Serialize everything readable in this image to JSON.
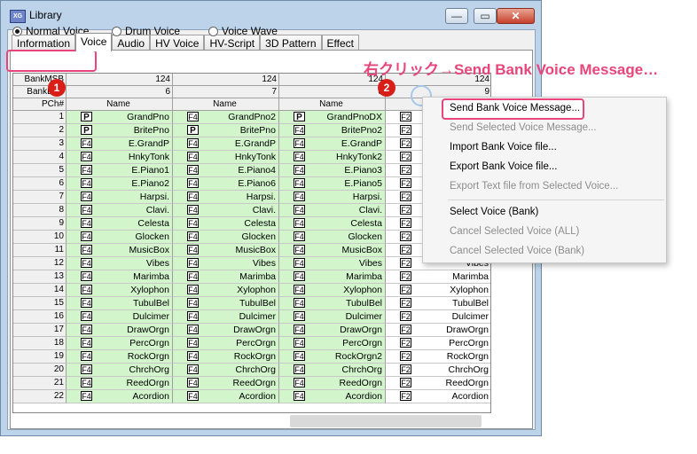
{
  "window": {
    "title": "Library",
    "icon_text": "XG",
    "buttons": {
      "minimize": "—",
      "maximize": "▭",
      "close": "✕"
    }
  },
  "tabs": [
    "Information",
    "Voice",
    "Audio",
    "HV Voice",
    "HV-Script",
    "3D Pattern",
    "Effect"
  ],
  "active_tab": "Voice",
  "radios": {
    "normal_voice": "Normal Voice",
    "drum_voice": "Drum Voice",
    "voice_wave": "Voice Wave",
    "selected": "normal_voice"
  },
  "annotation": {
    "instruction": "右クリック→Send Bank Voice Message…",
    "step1": "1",
    "step2": "2",
    "highlight_color": "#e8457a"
  },
  "grid": {
    "header_labels": {
      "msb": "BankMSB",
      "lsb": "BankLSB",
      "pch": "PCh#",
      "name": "Name"
    },
    "msb_values": [
      "124",
      "124",
      "124",
      "124"
    ],
    "lsb_values": [
      "6",
      "7",
      "8",
      "9"
    ],
    "columns": [
      {
        "badges": [
          "P",
          "P",
          "F4",
          "F4",
          "F4",
          "F4",
          "F4",
          "F4",
          "F4",
          "F4",
          "F4",
          "F4",
          "F4",
          "F4",
          "F4",
          "F4",
          "F4",
          "F4",
          "F4",
          "F4",
          "F4",
          "F4"
        ],
        "names": [
          "GrandPno",
          "BritePno",
          "E.GrandP",
          "HnkyTonk",
          "E.Piano1",
          "E.Piano2",
          "Harpsi.",
          "Clavi.",
          "Celesta",
          "Glocken",
          "MusicBox",
          "Vibes",
          "Marimba",
          "Xylophon",
          "TubulBel",
          "Dulcimer",
          "DrawOrgn",
          "PercOrgn",
          "RockOrgn",
          "ChrchOrg",
          "ReedOrgn",
          "Acordion"
        ]
      },
      {
        "badges": [
          "F4",
          "P",
          "F4",
          "F4",
          "F4",
          "F4",
          "F4",
          "F4",
          "F4",
          "F4",
          "F4",
          "F4",
          "F4",
          "F4",
          "F4",
          "F4",
          "F4",
          "F4",
          "F4",
          "F4",
          "F4",
          "F4"
        ],
        "names": [
          "GrandPno2",
          "BritePno",
          "E.GrandP",
          "HnkyTonk",
          "E.Piano4",
          "E.Piano6",
          "Harpsi.",
          "Clavi.",
          "Celesta",
          "Glocken",
          "MusicBox",
          "Vibes",
          "Marimba",
          "Xylophon",
          "TubulBel",
          "Dulcimer",
          "DrawOrgn",
          "PercOrgn",
          "RockOrgn",
          "ChrchOrg",
          "ReedOrgn",
          "Acordion"
        ]
      },
      {
        "badges": [
          "P",
          "F4",
          "F4",
          "F4",
          "F4",
          "F4",
          "F4",
          "F4",
          "F4",
          "F4",
          "F4",
          "F4",
          "F4",
          "F4",
          "F4",
          "F4",
          "F4",
          "F4",
          "F4",
          "F4",
          "F4",
          "F4"
        ],
        "names": [
          "GrandPnoDX",
          "BritePno2",
          "E.GrandP",
          "HnkyTonk2",
          "E.Piano3",
          "E.Piano5",
          "Harpsi.",
          "Clavi.",
          "Celesta",
          "Glocken",
          "MusicBox",
          "Vibes",
          "Marimba",
          "Xylophon",
          "TubulBel",
          "Dulcimer",
          "DrawOrgn",
          "PercOrgn",
          "RockOrgn2",
          "ChrchOrg",
          "ReedOrgn",
          "Acordion"
        ]
      },
      {
        "badges": [
          "F2",
          "F2",
          "F2",
          "F2",
          "F2",
          "F2",
          "F2",
          "F2",
          "F2",
          "F2",
          "F2",
          "F2",
          "F2",
          "F2",
          "F2",
          "F2",
          "F2",
          "F2",
          "F2",
          "F2",
          "F2",
          "F2"
        ],
        "names": [
          "",
          "",
          "",
          "",
          "",
          "",
          "",
          "",
          "",
          "",
          "",
          "Vibes",
          "Marimba",
          "Xylophon",
          "TubulBel",
          "Dulcimer",
          "DrawOrgn",
          "PercOrgn",
          "RockOrgn",
          "ChrchOrg",
          "ReedOrgn",
          "Acordion"
        ]
      }
    ]
  },
  "context_menu": {
    "items": [
      {
        "label": "Send Bank Voice Message...",
        "enabled": true,
        "highlighted": true
      },
      {
        "label": "Send Selected Voice Message...",
        "enabled": false
      },
      {
        "label": "Import Bank Voice file...",
        "enabled": true
      },
      {
        "label": "Export Bank Voice file...",
        "enabled": true
      },
      {
        "label": "Export Text file from Selected Voice...",
        "enabled": false
      },
      {
        "label": "Select Voice (Bank)",
        "enabled": true
      },
      {
        "label": "Cancel Selected Voice (ALL)",
        "enabled": false
      },
      {
        "label": "Cancel Selected Voice (Bank)",
        "enabled": false
      }
    ]
  },
  "colors": {
    "voice_cell_bg": "#d2f5cc",
    "window_frame": "#bcd3ea",
    "close_button": "#c7412c"
  }
}
